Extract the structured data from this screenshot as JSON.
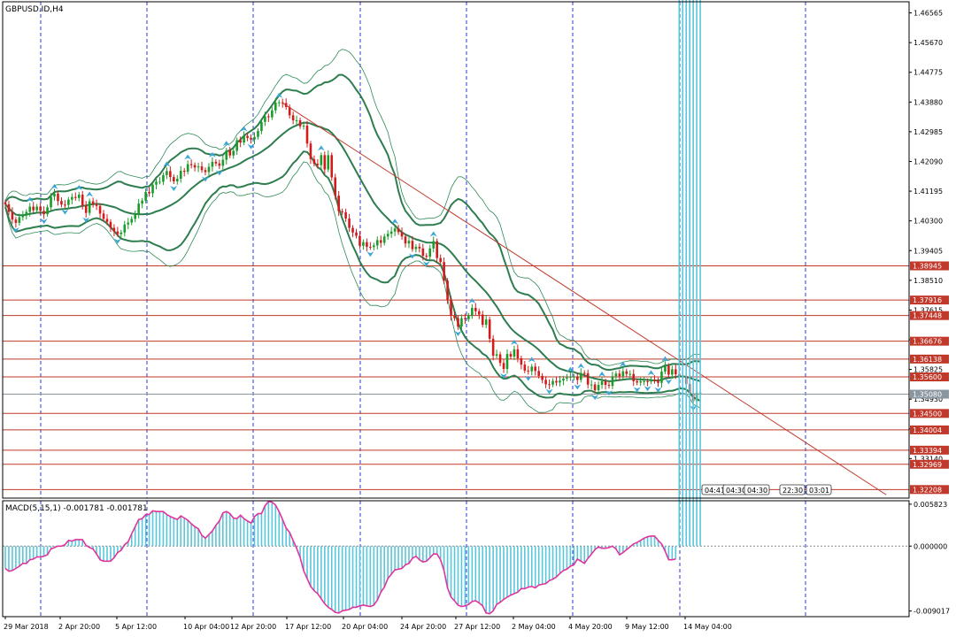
{
  "chart_data": [
    {
      "type": "candlestick",
      "title": "GBPUSD.ID,H4",
      "symbol": "GBPUSD.ID",
      "timeframe": "H4",
      "ylim": [
        1.3195,
        1.469
      ],
      "y_ticks": [
        "1.46565",
        "1.45670",
        "1.44775",
        "1.43880",
        "1.42985",
        "1.42090",
        "1.41195",
        "1.40300",
        "1.39405",
        "1.38510",
        "1.37615",
        "1.36720",
        "1.35825",
        "1.34930",
        "1.34035",
        "1.33140"
      ],
      "x_ticks": [
        "29 Mar 2018",
        "2 Apr 20:00",
        "5 Apr 12:00",
        "10 Apr 04:00",
        "12 Apr 20:00",
        "17 Apr 12:00",
        "20 Apr 04:00",
        "24 Apr 20:00",
        "27 Apr 12:00",
        "2 May 04:00",
        "4 May 20:00",
        "9 May 12:00",
        "14 May 04:00"
      ],
      "price_levels": [
        {
          "label": "1.38945",
          "value": 1.38945,
          "color": "#c0392b"
        },
        {
          "label": "1.37916",
          "value": 1.37916,
          "color": "#c0392b"
        },
        {
          "label": "1.37448",
          "value": 1.37448,
          "color": "#c0392b"
        },
        {
          "label": "1.36676",
          "value": 1.36676,
          "color": "#c0392b"
        },
        {
          "label": "1.36138",
          "value": 1.36138,
          "color": "#c0392b"
        },
        {
          "label": "1.35600",
          "value": 1.356,
          "color": "#c0392b"
        },
        {
          "label": "1.35080",
          "value": 1.3508,
          "color": "#8a96a0"
        },
        {
          "label": "1.34500",
          "value": 1.345,
          "color": "#c0392b"
        },
        {
          "label": "1.34004",
          "value": 1.34004,
          "color": "#c0392b"
        },
        {
          "label": "1.33394",
          "value": 1.33394,
          "color": "#c0392b"
        },
        {
          "label": "1.32969",
          "value": 1.32969,
          "color": "#c0392b"
        },
        {
          "label": "1.32208",
          "value": 1.32208,
          "color": "#c0392b"
        }
      ],
      "trendline": {
        "from_bar": 79,
        "from_price": 1.4385,
        "to_bar": 251,
        "to_price": 1.3205,
        "color": "#c0392b"
      },
      "series": [
        {
          "values": [
            1.408,
            1.4057,
            1.4034,
            1.4024,
            1.4041,
            1.4046,
            1.4057,
            1.4073,
            1.4062,
            1.4073,
            1.406,
            1.405,
            1.4071,
            1.4103,
            1.4112,
            1.409,
            1.4079,
            1.4078,
            1.4094,
            1.4102,
            1.4099,
            1.4109,
            1.4076,
            1.4054,
            1.4089,
            1.408,
            1.4075,
            1.4052,
            1.4036,
            1.4027,
            1.4009,
            1.3998,
            1.399,
            1.3995,
            1.4019,
            1.4025,
            1.4036,
            1.405,
            1.4082,
            1.4091,
            1.4117,
            1.4113,
            1.4139,
            1.4148,
            1.4148,
            1.4168,
            1.418,
            1.4162,
            1.4149,
            1.4157,
            1.4181,
            1.4178,
            1.4201,
            1.4198,
            1.4191,
            1.4194,
            1.4183,
            1.4177,
            1.4193,
            1.4208,
            1.4203,
            1.4196,
            1.4214,
            1.4242,
            1.4227,
            1.4241,
            1.4273,
            1.4266,
            1.4286,
            1.428,
            1.4275,
            1.4283,
            1.4301,
            1.4328,
            1.4345,
            1.4342,
            1.4363,
            1.4386,
            1.4387,
            1.4385,
            1.4373,
            1.4348,
            1.4333,
            1.4333,
            1.4315,
            1.4317,
            1.4263,
            1.4216,
            1.4202,
            1.4198,
            1.4228,
            1.4185,
            1.4228,
            1.4161,
            1.4106,
            1.4059,
            1.4056,
            1.4037,
            1.4009,
            1.3995,
            1.3985,
            1.3955,
            1.3966,
            1.3952,
            1.3951,
            1.3956,
            1.3972,
            1.3964,
            1.3983,
            1.3991,
            1.3998,
            1.4007,
            1.3996,
            1.3983,
            1.3962,
            1.397,
            1.3945,
            1.3952,
            1.3947,
            1.3925,
            1.3922,
            1.3947,
            1.3969,
            1.3918,
            1.3906,
            1.385,
            1.3792,
            1.3744,
            1.3737,
            1.3712,
            1.3737,
            1.3734,
            1.3745,
            1.3768,
            1.3758,
            1.3748,
            1.3717,
            1.3733,
            1.3675,
            1.3624,
            1.3628,
            1.3602,
            1.3584,
            1.3629,
            1.3621,
            1.3643,
            1.3616,
            1.3597,
            1.3579,
            1.3577,
            1.3591,
            1.3578,
            1.3563,
            1.3551,
            1.3538,
            1.3537,
            1.3548,
            1.3543,
            1.3549,
            1.3555,
            1.3558,
            1.3561,
            1.3561,
            1.3551,
            1.3572,
            1.3571,
            1.3537,
            1.3537,
            1.352,
            1.3536,
            1.3547,
            1.3536,
            1.3533,
            1.3562,
            1.357,
            1.3562,
            1.3577,
            1.3569,
            1.3569,
            1.3547,
            1.3543,
            1.3547,
            1.3547,
            1.3546,
            1.3551,
            1.355,
            1.3542,
            1.3576,
            1.3593,
            1.3567,
            1.3583,
            1.3568,
            1.3562,
            1.3563,
            1.3539,
            1.3511,
            1.3487,
            1.3513,
            1.3511
          ]
        }
      ]
    },
    {
      "type": "histogram",
      "title": "MACD(5,15,1) -0.001781 -0.001781",
      "ylim": [
        -0.0098,
        0.0063
      ],
      "y_ticks": [
        "0.005823",
        "0.000000",
        "-0.009017"
      ],
      "series": [
        {
          "values": [
            -0.0031,
            -0.0035,
            -0.0034,
            -0.0031,
            -0.0028,
            -0.0024,
            -0.0024,
            -0.0019,
            -0.0018,
            -0.0015,
            -0.0015,
            -0.0014,
            -0.0012,
            -0.0004,
            -0.0002,
            0.0,
            0.0,
            0.0002,
            0.0008,
            0.0007,
            0.0009,
            0.0009,
            0.0009,
            0.0001,
            -0.0002,
            -0.0004,
            -0.0011,
            -0.0019,
            -0.0021,
            -0.0021,
            -0.0021,
            -0.0016,
            -0.0009,
            -0.0006,
            0.0002,
            0.0006,
            0.0017,
            0.0027,
            0.0037,
            0.0038,
            0.0044,
            0.0044,
            0.0049,
            0.0048,
            0.0048,
            0.0048,
            0.0044,
            0.0041,
            0.0039,
            0.0037,
            0.0042,
            0.0039,
            0.0036,
            0.0031,
            0.0027,
            0.0024,
            0.0015,
            0.0011,
            0.0016,
            0.0021,
            0.0029,
            0.0035,
            0.0046,
            0.0048,
            0.0045,
            0.0039,
            0.0038,
            0.0043,
            0.0038,
            0.0035,
            0.0032,
            0.0041,
            0.0045,
            0.0045,
            0.0056,
            0.0062,
            0.0061,
            0.0057,
            0.0048,
            0.0037,
            0.0025,
            0.0019,
            0.0008,
            -0.0003,
            -0.0016,
            -0.0034,
            -0.0045,
            -0.0056,
            -0.0062,
            -0.0066,
            -0.0073,
            -0.008,
            -0.0085,
            -0.0088,
            -0.0092,
            -0.0093,
            -0.009,
            -0.0089,
            -0.0088,
            -0.0085,
            -0.0085,
            -0.0083,
            -0.0082,
            -0.0083,
            -0.0084,
            -0.0082,
            -0.0075,
            -0.0064,
            -0.0057,
            -0.0045,
            -0.0039,
            -0.0033,
            -0.0032,
            -0.0031,
            -0.0026,
            -0.0024,
            -0.0017,
            -0.0014,
            -0.0019,
            -0.0022,
            -0.0021,
            -0.0016,
            -0.0011,
            -0.0011,
            -0.0019,
            -0.0034,
            -0.0058,
            -0.0071,
            -0.0076,
            -0.0082,
            -0.0084,
            -0.0083,
            -0.0081,
            -0.0077,
            -0.0076,
            -0.0079,
            -0.0083,
            -0.0093,
            -0.0094,
            -0.009,
            -0.0081,
            -0.0078,
            -0.0074,
            -0.0071,
            -0.0068,
            -0.0066,
            -0.0064,
            -0.0059,
            -0.0059,
            -0.0057,
            -0.0056,
            -0.0058,
            -0.0054,
            -0.0053,
            -0.0052,
            -0.0048,
            -0.0046,
            -0.0043,
            -0.0038,
            -0.0034,
            -0.0032,
            -0.0028,
            -0.0026,
            -0.0018,
            -0.0021,
            -0.0024,
            -0.0017,
            -0.0011,
            -0.0005,
            -0.0001,
            -0.0003,
            -0.0003,
            -0.0002,
            0.0,
            -0.0004,
            -0.0012,
            -0.0009,
            -0.0005,
            -0.0001,
            0.0003,
            0.0005,
            0.0008,
            0.0011,
            0.0013,
            0.0014,
            0.0014,
            0.0008,
            0.0003,
            -0.0007,
            -0.0019,
            -0.0019,
            -0.0018
          ]
        }
      ]
    }
  ],
  "time_boxes": [
    "04:41",
    "04:30",
    "04:30",
    "22:30",
    "03:01"
  ]
}
